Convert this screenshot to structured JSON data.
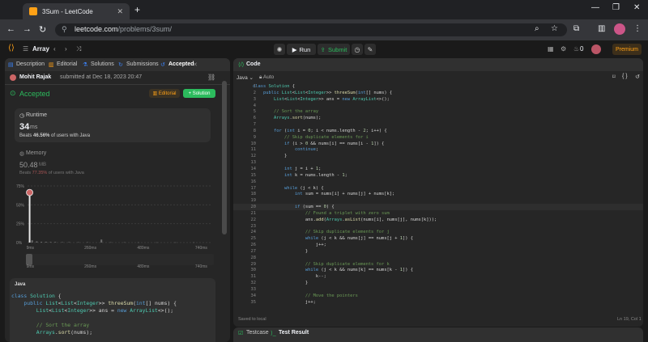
{
  "browser": {
    "tab_title": "3Sum - LeetCode",
    "url_host": "leetcode.com",
    "url_path": "/problems/3sum/"
  },
  "header": {
    "problem_list": "Array",
    "run": "Run",
    "submit": "Submit",
    "streak": "0",
    "premium": "Premium"
  },
  "left_tabs": [
    "Description",
    "Editorial",
    "Solutions",
    "Submissions",
    "Accepted"
  ],
  "submission": {
    "user": "Mohit Rajak",
    "submitted_text": "submitted at Dec 18, 2023 20:47",
    "status": "Accepted",
    "editorial_btn": "Editorial",
    "solution_btn": "Solution",
    "runtime_label": "Runtime",
    "runtime_value": "34",
    "runtime_unit": "ms",
    "beats_runtime_prefix": "Beats",
    "beats_runtime_pct": "46.56%",
    "beats_runtime_suffix": "of users with Java",
    "memory_label": "Memory",
    "memory_value": "50.48",
    "memory_unit": "MB",
    "beats_memory_prefix": "Beats",
    "beats_memory_pct": "77.35%",
    "beats_memory_suffix": "of users with Java"
  },
  "chart_data": {
    "type": "bar",
    "y_ticks": [
      "75%",
      "50%",
      "25%",
      "0%"
    ],
    "x_ticks": [
      "9ms",
      "260ms",
      "489ms",
      "740ms"
    ],
    "range_ticks": [
      "9ms",
      "260ms",
      "489ms",
      "740ms"
    ],
    "ylim": [
      0,
      75
    ],
    "highlight_pct": 62,
    "bars": [
      {
        "x": 9,
        "y": 62
      },
      {
        "x": 20,
        "y": 3
      },
      {
        "x": 40,
        "y": 1.5
      },
      {
        "x": 60,
        "y": 1
      },
      {
        "x": 80,
        "y": 1
      },
      {
        "x": 100,
        "y": 0.8
      },
      {
        "x": 120,
        "y": 0.8
      },
      {
        "x": 150,
        "y": 0.6
      },
      {
        "x": 180,
        "y": 0.6
      },
      {
        "x": 220,
        "y": 0.5
      },
      {
        "x": 260,
        "y": 0.5
      },
      {
        "x": 320,
        "y": 4
      },
      {
        "x": 360,
        "y": 0.4
      },
      {
        "x": 420,
        "y": 0.4
      },
      {
        "x": 480,
        "y": 0.3
      },
      {
        "x": 560,
        "y": 0.3
      },
      {
        "x": 640,
        "y": 0.3
      },
      {
        "x": 720,
        "y": 0.3
      }
    ]
  },
  "left_code": {
    "lang": "Java",
    "lines": [
      "class Solution {",
      "    public List<List<Integer>> threeSum(int[] nums) {",
      "        List<List<Integer>> ans = new ArrayList<>();",
      "",
      "        // Sort the array",
      "        Arrays.sort(nums);"
    ]
  },
  "editor": {
    "title": "Code",
    "lang": "Java",
    "auto": "Auto",
    "saved": "Saved to local",
    "cursor": "Ln 19, Col 1",
    "lines": [
      "class Solution {",
      "    public List<List<Integer>> threeSum(int[] nums) {",
      "        List<List<Integer>> ans = new ArrayList<>();",
      "",
      "        // Sort the array",
      "        Arrays.sort(nums);",
      "",
      "        for (int i = 0; i < nums.length - 2; i++) {",
      "            // Skip duplicate elements for i",
      "            if (i > 0 && nums[i] == nums[i - 1]) {",
      "                continue;",
      "            }",
      "",
      "            int j = i + 1;",
      "            int k = nums.length - 1;",
      "",
      "            while (j < k) {",
      "                int sum = nums[i] + nums[j] + nums[k];",
      "",
      "                if (sum == 0) {",
      "                    // Found a triplet with zero sum",
      "                    ans.add(Arrays.asList(nums[i], nums[j], nums[k]));",
      "",
      "                    // Skip duplicate elements for j",
      "                    while (j < k && nums[j] == nums[j + 1]) {",
      "                        j++;",
      "                    }",
      "",
      "                    // Skip duplicate elements for k",
      "                    while (j < k && nums[k] == nums[k - 1]) {",
      "                        k--;",
      "                    }",
      "",
      "                    // Move the pointers",
      "                    j++;"
    ]
  },
  "bottom": {
    "testcase": "Testcase",
    "result": "Test Result"
  },
  "colors": {
    "accent": "#ffa116",
    "success": "#2cbb5d",
    "chart_bar": "#6b6b6b",
    "highlight_bar": "#e8e8e8"
  }
}
